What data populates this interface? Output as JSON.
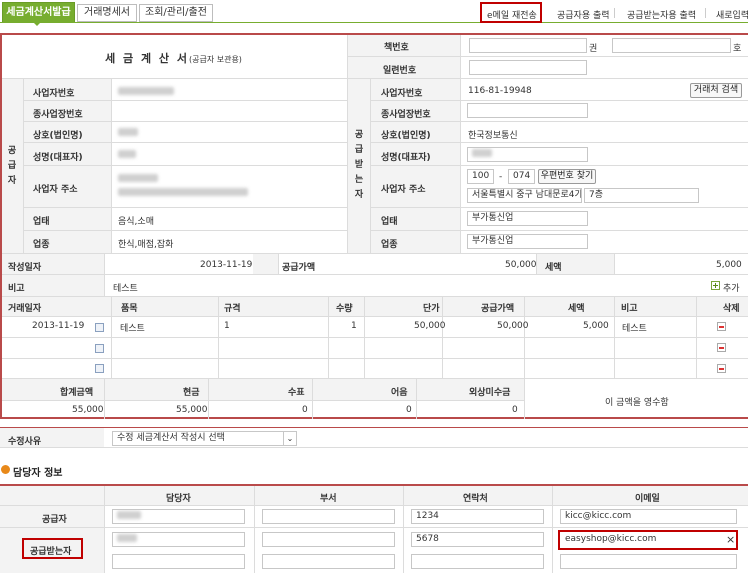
{
  "tabs": [
    {
      "label": "세금계산서발급",
      "active": true
    },
    {
      "label": "거래명세서",
      "active": false
    },
    {
      "label": "조회/관리/출전",
      "active": false
    }
  ],
  "top_links": {
    "email_resend": "e메일 재전송",
    "print_supplier": "공급자용 출력",
    "print_receiver": "공급받는자용 출력",
    "new_input": "새로입력"
  },
  "invoice": {
    "title_main": "세 금 계 산 서",
    "title_sub": "(공급자 보관용)",
    "book_no_label": "책번호",
    "book_unit_1": "권",
    "book_unit_2": "호",
    "serial_no_label": "일련번호"
  },
  "supplier": {
    "side_label": "공급자",
    "reg_no_label": "사업자번호",
    "sub_reg_no_label": "종사업장번호",
    "company_label": "상호(법인명)",
    "ceo_label": "성명(대표자)",
    "address_label": "사업자 주소",
    "business_type_label": "업태",
    "business_type": "음식,소매",
    "business_item_label": "업종",
    "business_item": "한식,매점,잡화"
  },
  "receiver": {
    "side_label": "공급받는자",
    "reg_no_label": "사업자번호",
    "reg_no": "116-81-19948",
    "search_button": "거래처 검색",
    "sub_reg_no_label": "종사업장번호",
    "company_label": "상호(법인명)",
    "company": "한국정보통신",
    "ceo_label": "성명(대표자)",
    "address_label": "사업자 주소",
    "zip1": "100",
    "zip_dash": "-",
    "zip2": "074",
    "zip_button": "우편번호 찾기",
    "address1": "서울특별시 중구 남대문로4가",
    "address2": "7층",
    "business_type_label": "업태",
    "business_type": "부가통신업",
    "business_item_label": "업종",
    "business_item": "부가통신업"
  },
  "summary": {
    "date_label": "작성일자",
    "date": "2013-11-19",
    "supply_label": "공급가액",
    "supply": "50,000",
    "tax_label": "세액",
    "tax": "5,000",
    "note_label": "비고",
    "note": "테스트",
    "add_label": "추가"
  },
  "items": {
    "headers": [
      "거래일자",
      "품목",
      "규격",
      "수량",
      "단가",
      "공급가액",
      "세액",
      "비고",
      "삭제"
    ],
    "rows": [
      {
        "date": "2013-11-19",
        "item": "테스트",
        "spec": "1",
        "qty": "1",
        "price": "50,000",
        "supply": "50,000",
        "tax": "5,000",
        "note": "테스트"
      },
      {
        "date": "",
        "item": "",
        "spec": "",
        "qty": "",
        "price": "",
        "supply": "",
        "tax": "",
        "note": ""
      },
      {
        "date": "",
        "item": "",
        "spec": "",
        "qty": "",
        "price": "",
        "supply": "",
        "tax": "",
        "note": ""
      }
    ]
  },
  "totals": {
    "headers": [
      "합계금액",
      "현금",
      "수표",
      "어음",
      "외상미수금"
    ],
    "values": [
      "55,000",
      "55,000",
      "0",
      "0",
      "0"
    ],
    "receipt_text": "이 금액을 영수함"
  },
  "modify": {
    "label": "수정사유",
    "select_value": "수정 세금계산서 작성시 선택"
  },
  "contacts": {
    "section_title": "담당자 정보",
    "headers": [
      "담당자",
      "부서",
      "연락처",
      "이메일"
    ],
    "supplier_label": "공급자",
    "supplier_phone": "1234",
    "supplier_email": "kicc@kicc.com",
    "receiver_label": "공급받는자",
    "receiver_phone": "5678",
    "receiver_email": "easyshop@kicc.com",
    "clear_icon": "×"
  },
  "colors": {
    "accent_green": "#77ad2f",
    "highlight_red": "#c00000",
    "invoice_border": "#b94a4a",
    "section_bullet": "#e8891a"
  }
}
